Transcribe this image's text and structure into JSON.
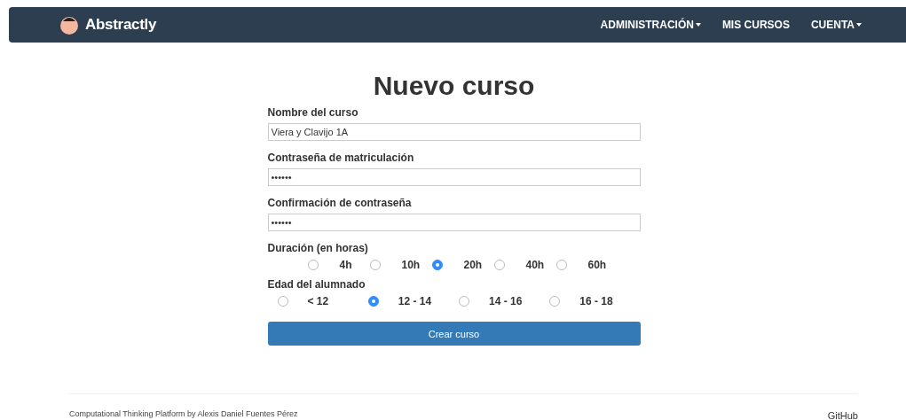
{
  "navbar": {
    "brand": "Abstractly",
    "items": [
      {
        "label": "ADMINISTRACIÓN",
        "dropdown": true
      },
      {
        "label": "MIS CURSOS",
        "dropdown": false
      },
      {
        "label": "CUENTA",
        "dropdown": true
      }
    ]
  },
  "title": "Nuevo curso",
  "fields": [
    {
      "label": "Nombre del curso",
      "value": "Viera y Clavijo 1A"
    },
    {
      "label": "Contraseña de matriculación",
      "value": "••••••"
    },
    {
      "label": "Confirmación de contraseña",
      "value": "••••••"
    }
  ],
  "radio_groups": [
    {
      "label": "Duración (en horas)",
      "kind": "narrow",
      "options": [
        {
          "label": "4h",
          "selected": false
        },
        {
          "label": "10h",
          "selected": false
        },
        {
          "label": "20h",
          "selected": true
        },
        {
          "label": "40h",
          "selected": false
        },
        {
          "label": "60h",
          "selected": false
        }
      ]
    },
    {
      "label": "Edad del alumnado",
      "kind": "wide",
      "options": [
        {
          "label": "< 12",
          "selected": false
        },
        {
          "label": "12 - 14",
          "selected": true
        },
        {
          "label": "14 - 16",
          "selected": false
        },
        {
          "label": "16 - 18",
          "selected": false
        }
      ]
    }
  ],
  "submit": "Crear curso",
  "footer": {
    "credit": "Computational Thinking Platform by Alexis Daniel Fuentes Pérez",
    "link": "GitHub"
  }
}
